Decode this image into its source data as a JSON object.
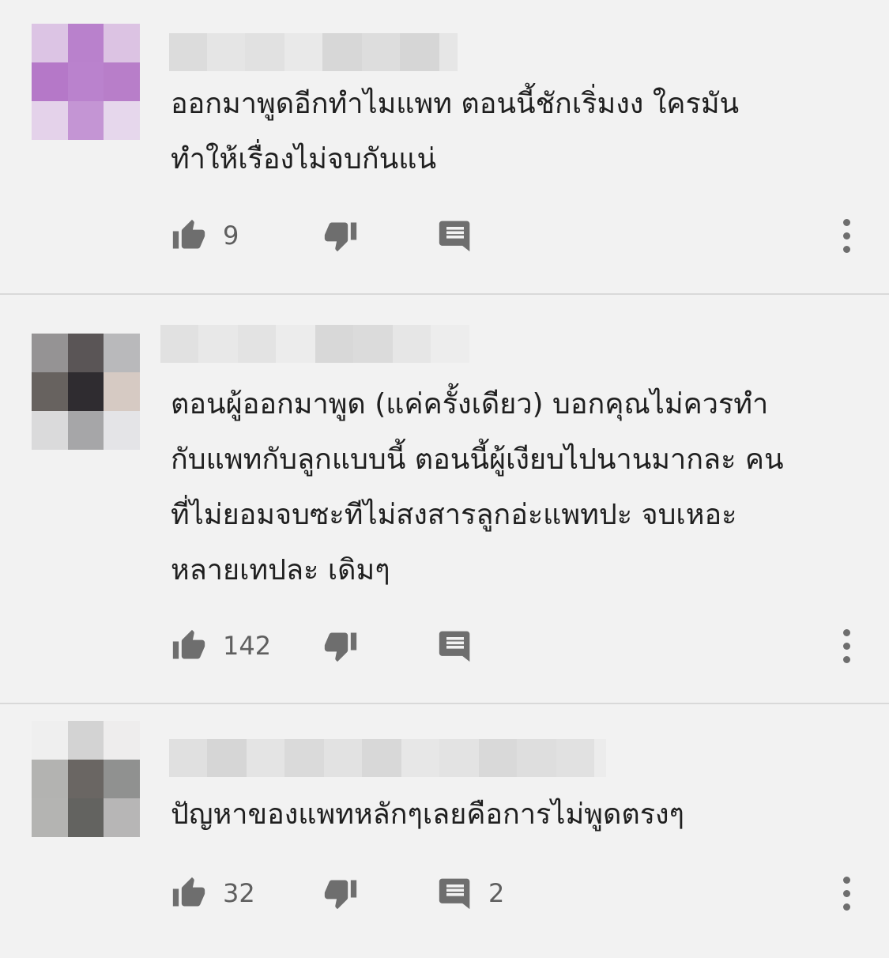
{
  "comments": [
    {
      "text": "ออกมาพูดอีกทำไมแพท ตอนนี้ชักเริ่มงง ใครมัน\nทำให้เรื่องไม่จบกันแน่",
      "likes": "9",
      "dislikes": "",
      "replies": "",
      "avatar_colors": [
        "#dcc4e4",
        "#b981cc",
        "#dcc3e3",
        "#b578c8",
        "#ba82cd",
        "#b87ec9",
        "#e4d2ea",
        "#c495d4",
        "#e6d7ec"
      ]
    },
    {
      "text": "ตอนผู้ออกมาพูด (แค่ครั้งเดียว) บอกคุณไม่ควรทำ\nกับแพทกับลูกแบบนี้ ตอนนี้ผู้เงียบไปนานมากละ คน\nที่ไม่ยอมจบซะทีไม่สงสารลูกอ่ะแพทปะ จบเหอะ\nหลายเทปละ เดิมๆ",
      "likes": "142",
      "dislikes": "",
      "replies": "",
      "avatar_colors": [
        "#959394",
        "#5a5556",
        "#b9b9bb",
        "#67625f",
        "#2f2c30",
        "#d6cac3",
        "#dadadb",
        "#a6a6a8",
        "#e4e4e7"
      ]
    },
    {
      "text": "ปัญหาของแพทหลักๆเลยคือการไม่พูดตรงๆ",
      "likes": "32",
      "dislikes": "",
      "replies": "2",
      "avatar_colors": [
        "#efefef",
        "#d3d3d3",
        "#eeeded",
        "#b3b3b1",
        "#6a6663",
        "#909190",
        "#b4b4b2",
        "#636360",
        "#b7b6b6"
      ]
    }
  ],
  "icons": {
    "like": "thumb-up-icon",
    "dislike": "thumb-down-icon",
    "reply": "comment-icon",
    "more": "more-vert-icon"
  },
  "colors": {
    "background": "#f2f2f2",
    "text": "#1f1f1f",
    "icon": "#6e6e6e",
    "count": "#5f5f5f"
  }
}
